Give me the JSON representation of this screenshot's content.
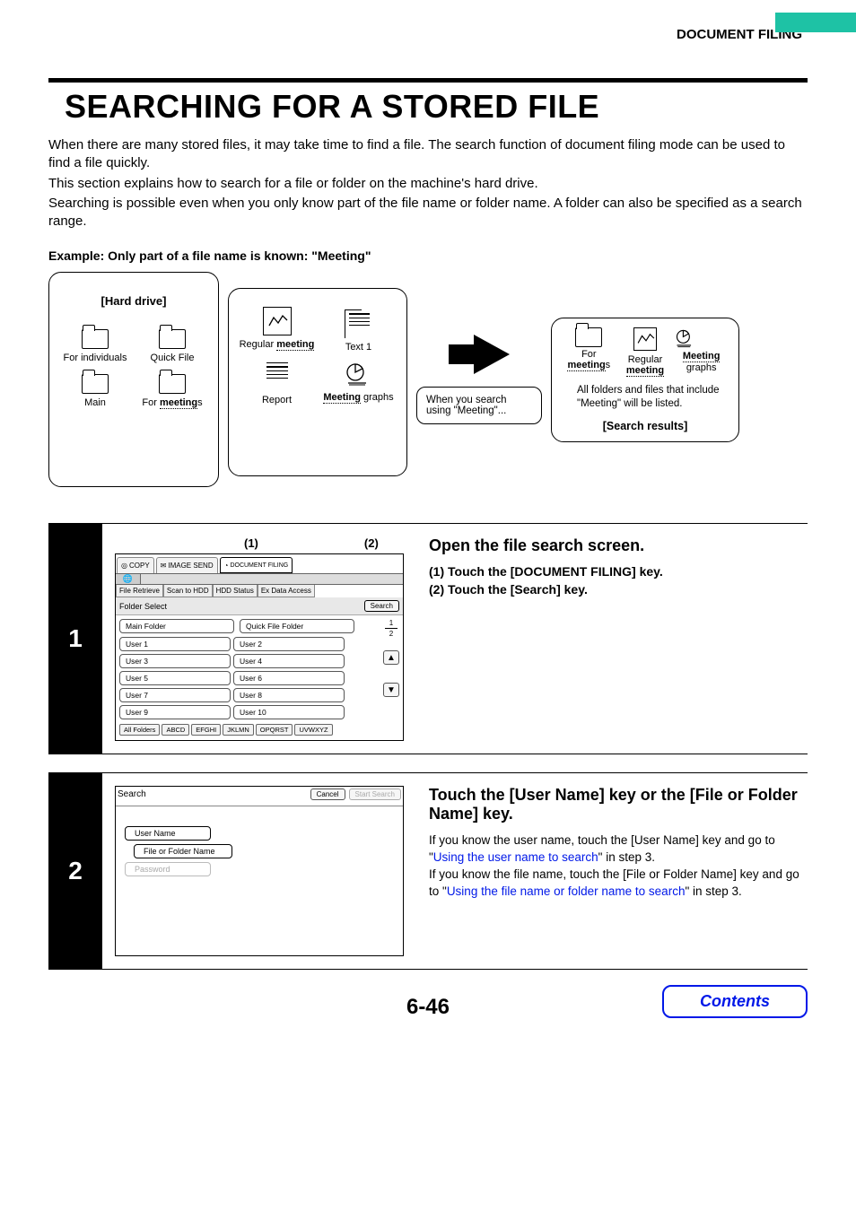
{
  "header": {
    "section": "DOCUMENT FILING"
  },
  "title": "SEARCHING FOR A STORED FILE",
  "intro": {
    "p1": "When there are many stored files, it may take time to find a file. The search function of document filing mode can be used to find a file quickly.",
    "p2": "This section explains how to search for a file or folder on the machine's hard drive.",
    "p3": "Searching is possible even when you only know part of the file name or folder name. A folder can also be specified as a search range."
  },
  "example_label": "Example: Only part of a file name is known: \"Meeting\"",
  "diagram": {
    "hard_drive_title": "[Hard drive]",
    "folders": {
      "f1": "For individuals",
      "f2": "Quick File",
      "f3": "Main",
      "f4_pre": "For ",
      "f4_bold": "meeting",
      "f4_suf": "s"
    },
    "files": {
      "a_pre": "Regular ",
      "a_bold": "meeting",
      "b": "Text 1",
      "c": "Report",
      "d_bold": "Meeting",
      "d_suf": " graphs"
    },
    "callout": "When you search using \"Meeting\"...",
    "results": {
      "r1_pre": "For",
      "r1_bold": "meeting",
      "r1_suf": "s",
      "r2_pre": "Regular",
      "r2_bold": "meeting",
      "r3_bold": "Meeting",
      "r3_suf": "graphs",
      "note": "All folders and files that include \"Meeting\" will be listed.",
      "label": "[Search results]"
    }
  },
  "step1": {
    "num": "1",
    "markers": {
      "m1": "(1)",
      "m2": "(2)"
    },
    "heading": "Open the file search screen.",
    "sub1": "(1)  Touch the [DOCUMENT FILING] key.",
    "sub2": "(2)  Touch the [Search] key.",
    "panel": {
      "tabs": {
        "copy": "COPY",
        "image_send": "IMAGE SEND",
        "doc_filing": "DOCUMENT FILING"
      },
      "subtabs": {
        "a": "File Retrieve",
        "b": "Scan to HDD",
        "c": "HDD Status",
        "d": "Ex Data Access"
      },
      "folder_select": "Folder Select",
      "search": "Search",
      "main_folder": "Main Folder",
      "quick_folder": "Quick File Folder",
      "users": [
        "User 1",
        "User 2",
        "User 3",
        "User 4",
        "User 5",
        "User 6",
        "User 7",
        "User 8",
        "User 9",
        "User 10"
      ],
      "page": {
        "top": "1",
        "bottom": "2"
      },
      "alpha": [
        "All Folders",
        "ABCD",
        "EFGHI",
        "JKLMN",
        "OPQRST",
        "UVWXYZ"
      ]
    }
  },
  "step2": {
    "num": "2",
    "heading": "Touch the [User Name] key or the [File or Folder Name] key.",
    "body_a": "If you know the user name, touch the [User Name] key and go to \"",
    "link_a": "Using the user name to search",
    "body_b": "\" in step 3.",
    "body_c": "If you know the file name, touch the [File or Folder Name] key and go to \"",
    "link_b": "Using the file name or folder name to search",
    "body_d": "\" in step 3.",
    "panel": {
      "title": "Search",
      "cancel": "Cancel",
      "start": "Start Search",
      "user_name": "User Name",
      "file_or_folder": "File or Folder Name",
      "password": "Password"
    }
  },
  "page_number": "6-46",
  "contents_btn": "Contents"
}
